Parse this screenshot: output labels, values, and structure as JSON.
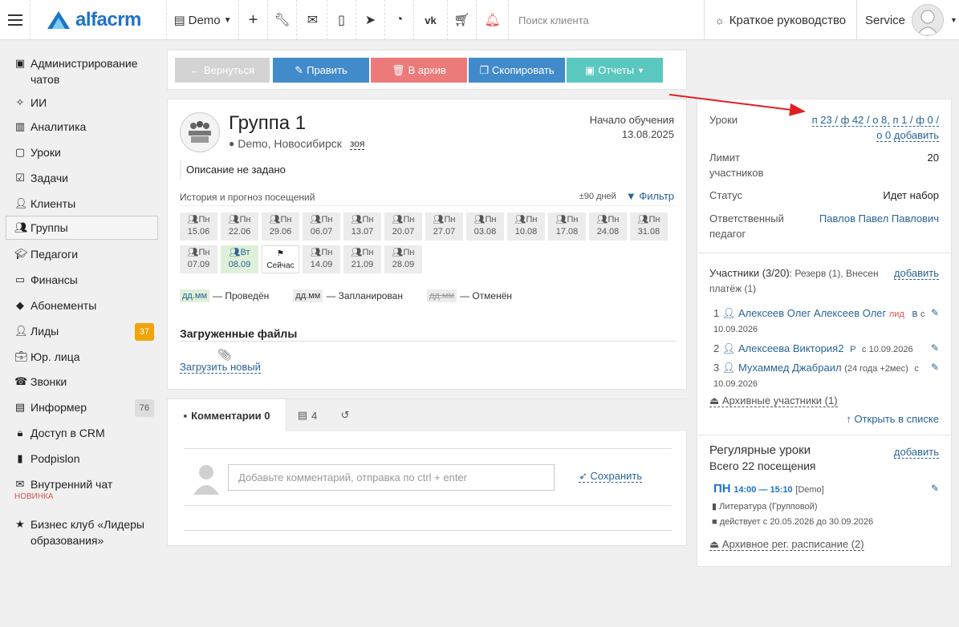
{
  "topbar": {
    "logo_text": "alfacrm",
    "branch": "Demo",
    "search_placeholder": "Поиск клиента",
    "guide_label": "Краткое руководство",
    "user_name": "Service",
    "icons": [
      "plus-icon",
      "wrench-icon",
      "envelope-icon",
      "phone-icon",
      "telegram-icon",
      "whatsapp-icon",
      "vk-icon",
      "cart-icon",
      "bell-icon"
    ]
  },
  "sidebar": {
    "items": [
      {
        "label": "Администрирование чатов",
        "icon": "chat-admin-icon"
      },
      {
        "label": "ИИ",
        "icon": "sparkle-icon"
      },
      {
        "label": "Аналитика",
        "icon": "map-icon"
      },
      {
        "label": "Уроки",
        "icon": "calendar-icon"
      },
      {
        "label": "Задачи",
        "icon": "checkbox-icon"
      },
      {
        "label": "Клиенты",
        "icon": "user-icon"
      },
      {
        "label": "Группы",
        "icon": "users-icon"
      },
      {
        "label": "Педагоги",
        "icon": "graduation-cap-icon"
      },
      {
        "label": "Финансы",
        "icon": "money-icon"
      },
      {
        "label": "Абонементы",
        "icon": "tag-icon"
      },
      {
        "label": "Лиды",
        "icon": "add-user-icon",
        "badge": "37"
      },
      {
        "label": "Юр. лица",
        "icon": "briefcase-icon"
      },
      {
        "label": "Звонки",
        "icon": "phone-icon"
      },
      {
        "label": "Информер",
        "icon": "inbox-icon",
        "badge": "76"
      },
      {
        "label": "Доступ в CRM",
        "icon": "lock-icon"
      },
      {
        "label": "Podpislon",
        "icon": "file-icon"
      },
      {
        "label": "Внутренний чат",
        "icon": "envelope-icon",
        "sub": "НОВИНКА"
      },
      {
        "label": "Бизнес клуб «Лидеры образования»",
        "icon": "star-icon"
      }
    ],
    "active_index": 6
  },
  "actions": {
    "back": "Вернуться",
    "edit": "Править",
    "archive": "В архив",
    "copy": "Скопировать",
    "reports": "Отчеты",
    "colors": {
      "back": "#d3d3d3",
      "edit": "#428bca",
      "archive": "#ed7a7a",
      "copy": "#428bca",
      "reports": "#5bc8c0"
    }
  },
  "group": {
    "title": "Группа 1",
    "location": "Demo, Новосибирск",
    "tag": "зоя",
    "start_label": "Начало обучения",
    "start_date": "13.08.2025",
    "description": "Описание не задано",
    "history_title": "История и прогноз посещений",
    "days_range": "±90 дней",
    "filter_label": "Фильтр",
    "days": [
      {
        "wd": "Пн",
        "date": "15.06"
      },
      {
        "wd": "Пн",
        "date": "22.06"
      },
      {
        "wd": "Пн",
        "date": "29.06"
      },
      {
        "wd": "Пн",
        "date": "06.07"
      },
      {
        "wd": "Пн",
        "date": "13.07"
      },
      {
        "wd": "Пн",
        "date": "20.07"
      },
      {
        "wd": "Пн",
        "date": "27.07"
      },
      {
        "wd": "Пн",
        "date": "03.08"
      },
      {
        "wd": "Пн",
        "date": "10.08"
      },
      {
        "wd": "Пн",
        "date": "17.08"
      },
      {
        "wd": "Пн",
        "date": "24.08"
      },
      {
        "wd": "Пн",
        "date": "31.08"
      },
      {
        "wd": "Пн",
        "date": "07.09"
      },
      {
        "wd": "Вт",
        "date": "08.09",
        "state": "current"
      },
      {
        "wd": "",
        "date": "Сейчас",
        "state": "now"
      },
      {
        "wd": "Пн",
        "date": "14.09"
      },
      {
        "wd": "Пн",
        "date": "21.09"
      },
      {
        "wd": "Пн",
        "date": "28.09"
      }
    ],
    "legend": [
      {
        "chip": "дд.мм",
        "text": "— Проведён",
        "bg": "#dff0d8",
        "color": "#2a6496"
      },
      {
        "chip": "дд.мм",
        "text": "— Запланирован",
        "bg": "#ececec",
        "color": "#333"
      },
      {
        "chip": "дд.мм",
        "text": "— Отменён",
        "bg": "#ececec",
        "color": "#999"
      }
    ],
    "files_title": "Загруженные файлы",
    "upload_label": "Загрузить новый"
  },
  "comments": {
    "tab_comments": "Комментарии 0",
    "tab_tasks_count": "4",
    "input_placeholder": "Добавьте комментарий, отправка по ctrl + enter",
    "save_label": "Сохранить"
  },
  "right": {
    "lessons_label": "Уроки",
    "lessons_stats_1": "п 23 / ф 42 / о 8,",
    "lessons_stats_2": "п 1 / ф 0 /",
    "lessons_stats_3": "о 0",
    "lessons_add": "добавить",
    "limit_label_1": "Лимит",
    "limit_label_2": "участников",
    "limit_value": "20",
    "status_label": "Статус",
    "status_value": "Идет набор",
    "teacher_label_1": "Ответственный",
    "teacher_label_2": "педагог",
    "teacher_value": "Павлов Павел Павлович",
    "members_title": "Участники (3/20)",
    "members_note_1": ": Резерв (1), Внесен",
    "members_note_2": "платёж (1)",
    "members_add": "добавить",
    "members": [
      {
        "num": "1",
        "name": "Алексеев Олег Алексеев Олег",
        "tag": "лид",
        "tag2": "в",
        "from": "с",
        "date": "10.09.2026"
      },
      {
        "num": "2",
        "name": "Алексеева Виктория2",
        "tag2": "Р",
        "from": "с 10.09.2026"
      },
      {
        "num": "3",
        "name": "Мухаммед Джабраил",
        "age": "(24 года +2мес)",
        "from": "с",
        "date": "10.09.2026"
      }
    ],
    "archived_members": "Архивные участники (1)",
    "open_list": "Открыть в списке",
    "regular_title": "Регулярные уроки",
    "regular_add": "добавить",
    "regular_total": "Всего 22 посещения",
    "regular_day": "ПН",
    "regular_time": "14:00 — 15:10",
    "regular_branch": "[Demo]",
    "regular_subject": "Литература (Групповой)",
    "regular_period": "действует с 20.05.2026 до 30.09.2026",
    "archived_schedule": "Архивное рег. расписание (2)"
  }
}
